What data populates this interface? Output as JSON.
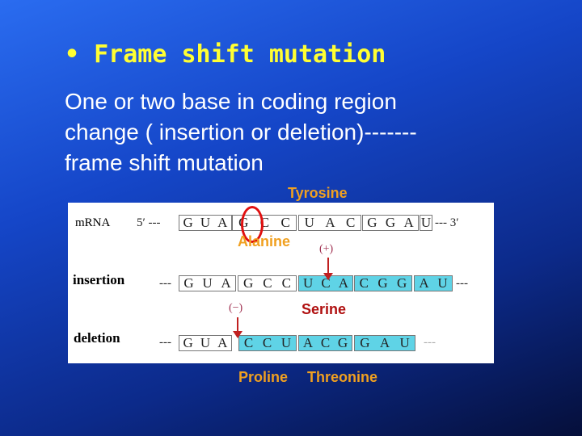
{
  "title": "• Frame shift mutation",
  "body": [
    "One or two base in coding region",
    "change ( insertion or deletion)-------",
    "frame shift mutation"
  ],
  "labels": {
    "tyrosine": "Tyrosine",
    "alanine": "Alanine",
    "serine": "Serine",
    "proline": "Proline",
    "threonine": "Threonine"
  },
  "figure": {
    "mrna": {
      "label": "mRNA",
      "five": "5′",
      "three": "3′",
      "codons": [
        [
          "G",
          "U",
          "A"
        ],
        [
          "G",
          "C",
          "C"
        ],
        [
          "U",
          "A",
          "C"
        ],
        [
          "G",
          "G",
          "A"
        ],
        [
          "U"
        ]
      ]
    },
    "insertion": {
      "label": "insertion",
      "sign": "(+)",
      "codons": [
        [
          "G",
          "U",
          "A"
        ],
        [
          "G",
          "C",
          "C"
        ],
        [
          "U",
          "C",
          "A"
        ],
        [
          "C",
          "G",
          "G"
        ],
        [
          "A",
          "U"
        ]
      ]
    },
    "deletion": {
      "label": "deletion",
      "sign": "(−)",
      "codons": [
        [
          "G",
          "U",
          "A"
        ],
        [
          "C",
          "C",
          "U"
        ],
        [
          "A",
          "C",
          "G"
        ],
        [
          "G",
          "A",
          "U"
        ]
      ]
    }
  },
  "colors": {
    "title": "#ffff33",
    "highlight": "#5fd3e6",
    "circle": "#e01010"
  }
}
